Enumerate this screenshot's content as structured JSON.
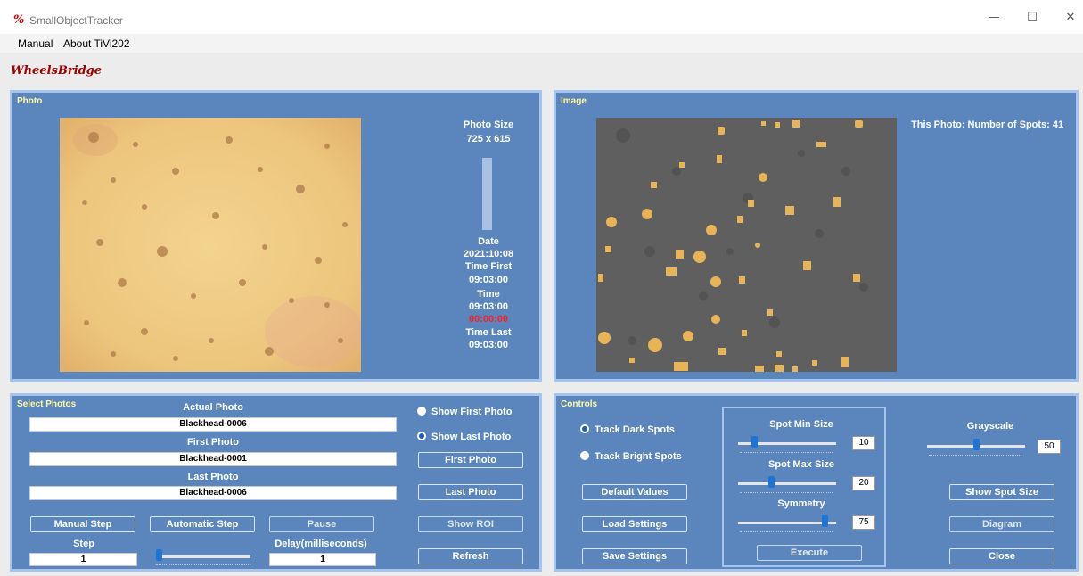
{
  "window": {
    "title": "SmallObjectTracker",
    "icon_glyph": "%",
    "minimize": "—",
    "maximize": "☐",
    "close": "✕"
  },
  "menu": [
    "Manual",
    "About TiVi202"
  ],
  "logo_text": "WheelsBridge",
  "photo_panel": {
    "title": "Photo",
    "photo_size_label": "Photo Size",
    "photo_size_value": "725 x 615",
    "date_label": "Date",
    "date_value": "2021:10:08",
    "time_first_label": "Time First",
    "time_first_value": "09:03:00",
    "time_label": "Time",
    "time_value": "09:03:00",
    "elapsed_value": "00:00:00",
    "time_last_label": "Time Last",
    "time_last_value": "09:03:00"
  },
  "image_panel": {
    "title": "Image",
    "spots_text": "This Photo: Number of Spots: 41"
  },
  "select_panel": {
    "title": "Select Photos",
    "actual_label": "Actual Photo",
    "actual_value": "Blackhead-0006",
    "first_label": "First Photo",
    "first_value": "Blackhead-0001",
    "last_label": "Last Photo",
    "last_value": "Blackhead-0006",
    "show_first": "Show First Photo",
    "show_last": "Show Last Photo",
    "first_photo_btn": "First Photo",
    "last_photo_btn": "Last Photo",
    "show_roi_btn": "Show ROI",
    "refresh_btn": "Refresh",
    "manual_step_btn": "Manual Step",
    "automatic_step_btn": "Automatic Step",
    "pause_btn": "Pause",
    "step_label": "Step",
    "step_value": "1",
    "delay_label": "Delay(milliseconds)",
    "delay_value": "1",
    "delay_slider_fraction": 0.02
  },
  "controls_panel": {
    "title": "Controls",
    "track_dark": "Track Dark Spots",
    "track_bright": "Track Bright Spots",
    "default_values_btn": "Default Values",
    "load_settings_btn": "Load Settings",
    "save_settings_btn": "Save Settings",
    "spot_min_label": "Spot Min Size",
    "spot_min_value": "10",
    "spot_max_label": "Spot Max Size",
    "spot_max_value": "20",
    "symmetry_label": "Symmetry",
    "symmetry_value": "75",
    "execute_btn": "Execute",
    "grayscale_label": "Grayscale",
    "grayscale_value": "50",
    "show_spot_size_btn": "Show Spot Size",
    "diagram_btn": "Diagram",
    "close_btn": "Close"
  },
  "colors": {
    "panel_bg": "#5b86bd",
    "panel_border": "#a6c5ee",
    "panel_title": "#fff9a6",
    "spot": "#e7b457",
    "image_bg": "#5d5d5d",
    "photo_bg": "#f0c77a"
  }
}
